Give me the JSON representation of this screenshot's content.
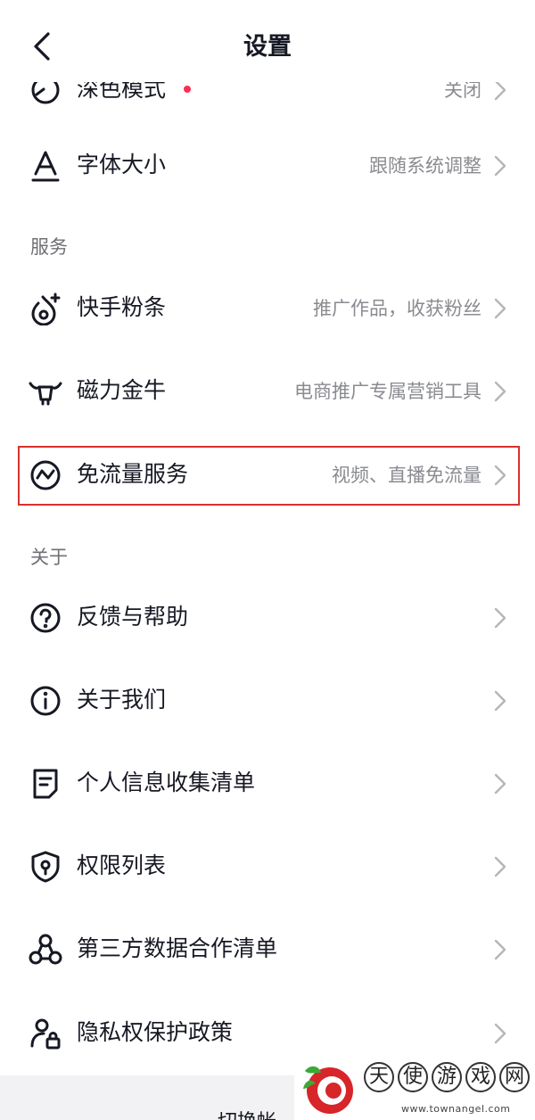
{
  "status_bar": {
    "text": "..."
  },
  "header": {
    "title": "设置"
  },
  "sections": {
    "display": {
      "items": [
        {
          "label": "深色模式",
          "value": "关闭",
          "icon": "dark-mode-icon"
        },
        {
          "label": "字体大小",
          "value": "跟随系统调整",
          "icon": "font-size-icon"
        }
      ]
    },
    "service": {
      "title": "服务",
      "items": [
        {
          "label": "快手粉条",
          "value": "推广作品，收获粉丝",
          "icon": "fire-plus-icon"
        },
        {
          "label": "磁力金牛",
          "value": "电商推广专属营销工具",
          "icon": "bull-icon"
        },
        {
          "label": "免流量服务",
          "value": "视频、直播免流量",
          "icon": "data-free-icon"
        }
      ]
    },
    "about": {
      "title": "关于",
      "items": [
        {
          "label": "反馈与帮助",
          "value": "",
          "icon": "question-icon"
        },
        {
          "label": "关于我们",
          "value": "",
          "icon": "info-icon"
        },
        {
          "label": "个人信息收集清单",
          "value": "",
          "icon": "document-icon"
        },
        {
          "label": "权限列表",
          "value": "",
          "icon": "shield-icon"
        },
        {
          "label": "第三方数据合作清单",
          "value": "",
          "icon": "share-network-icon"
        },
        {
          "label": "隐私权保护政策",
          "value": "",
          "icon": "user-lock-icon"
        }
      ]
    }
  },
  "bottom": {
    "partial_text": "切换帐"
  },
  "watermark": {
    "chars": [
      "天",
      "使",
      "游",
      "戏",
      "网"
    ],
    "url": "www.townangel.com"
  },
  "colors": {
    "accent_dot": "#fe2c55",
    "highlight_box": "#d9302c",
    "text_primary": "#161823",
    "text_secondary": "#8a8b91"
  }
}
